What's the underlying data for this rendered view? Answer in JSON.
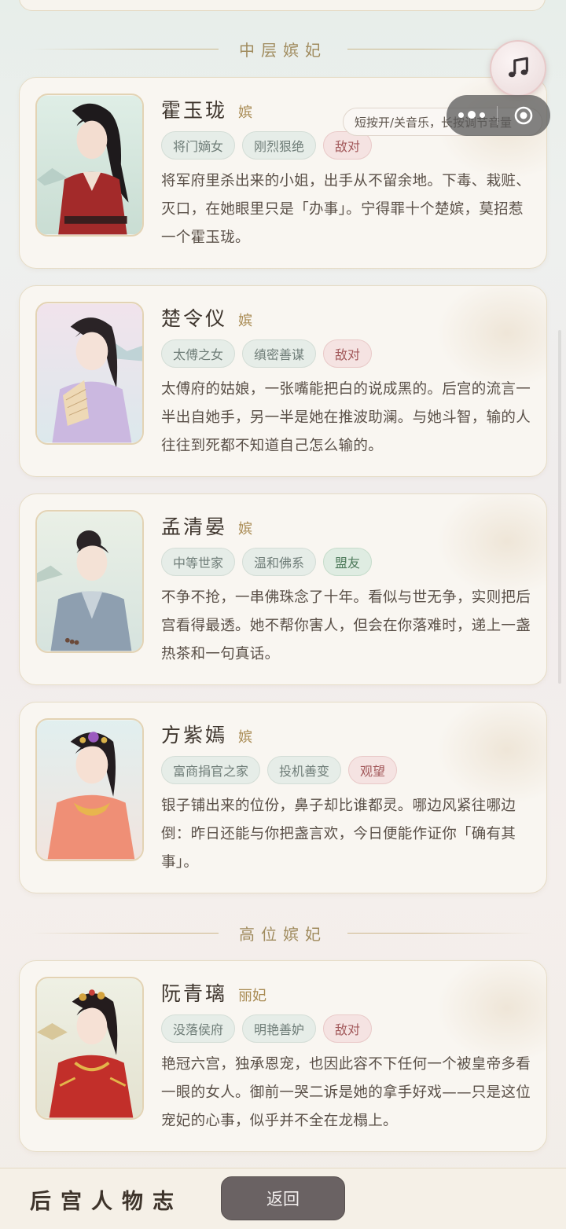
{
  "sections": {
    "middle": "中层嫔妃",
    "high": "高位嫔妃"
  },
  "music": {
    "icon": "music-note-icon",
    "tooltip": "短按开/关音乐，长按调节音量"
  },
  "characters": [
    {
      "name": "霍玉珑",
      "rank": "嫔",
      "tags": [
        "将门嫡女",
        "刚烈狠绝",
        "敌对"
      ],
      "stance": "hostile",
      "description": "将军府里杀出来的小姐，出手从不留余地。下毒、栽赃、灭口，在她眼里只是「办事」。宁得罪十个楚嫔，莫招惹一个霍玉珑。"
    },
    {
      "name": "楚令仪",
      "rank": "嫔",
      "tags": [
        "太傅之女",
        "缜密善谋",
        "敌对"
      ],
      "stance": "hostile",
      "description": "太傅府的姑娘，一张嘴能把白的说成黑的。后宫的流言一半出自她手，另一半是她在推波助澜。与她斗智，输的人往往到死都不知道自己怎么输的。"
    },
    {
      "name": "孟清晏",
      "rank": "嫔",
      "tags": [
        "中等世家",
        "温和佛系",
        "盟友"
      ],
      "stance": "ally",
      "description": "不争不抢，一串佛珠念了十年。看似与世无争，实则把后宫看得最透。她不帮你害人，但会在你落难时，递上一盏热茶和一句真话。"
    },
    {
      "name": "方紫嫣",
      "rank": "嫔",
      "tags": [
        "富商捐官之家",
        "投机善变",
        "观望"
      ],
      "stance": "neutral",
      "description": "银子铺出来的位份，鼻子却比谁都灵。哪边风紧往哪边倒：昨日还能与你把盏言欢，今日便能作证你「确有其事」。"
    },
    {
      "name": "阮青璃",
      "rank": "丽妃",
      "tags": [
        "没落侯府",
        "明艳善妒",
        "敌对"
      ],
      "stance": "hostile",
      "description": "艳冠六宫，独承恩宠，也因此容不下任何一个被皇帝多看一眼的女人。御前一哭二诉是她的拿手好戏——只是这位宠妃的心事，似乎并不全在龙榻上。"
    }
  ],
  "bottom": {
    "title": "后宫人物志",
    "back_label": "返回"
  },
  "colors": {
    "accent_gold": "#a08b5e",
    "hostile": "#a2585a",
    "ally": "#4d7a5a",
    "back_button": "#6a6263"
  }
}
